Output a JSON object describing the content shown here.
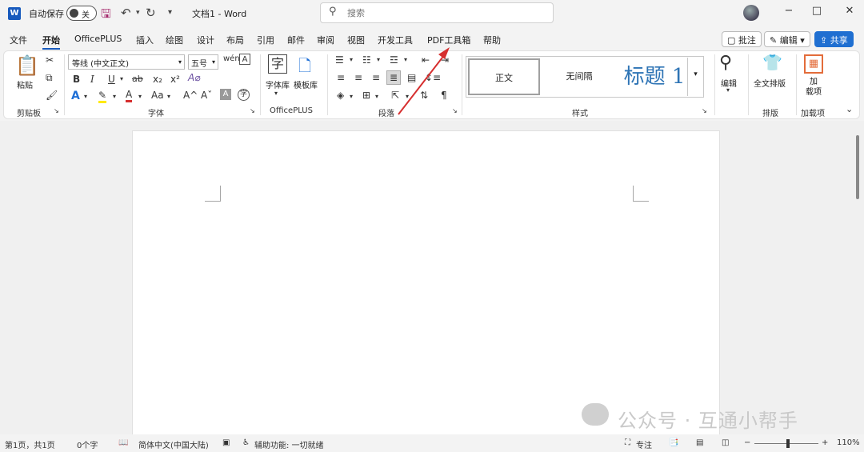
{
  "titlebar": {
    "app_logo": "W",
    "autosave_label": "自动保存",
    "autosave_state": "关",
    "doc_title": "文档1 - Word",
    "search_placeholder": "搜索",
    "window_controls": {
      "minimize": "−",
      "maximize": "□",
      "close": "✕"
    }
  },
  "menu": {
    "tabs": [
      "文件",
      "开始",
      "OfficePLUS",
      "插入",
      "绘图",
      "设计",
      "布局",
      "引用",
      "邮件",
      "审阅",
      "视图",
      "开发工具",
      "PDF工具箱",
      "帮助"
    ],
    "active_tab": "开始",
    "comments": "批注",
    "editing": "编辑",
    "share": "共享"
  },
  "ribbon": {
    "clipboard": {
      "paste": "粘贴",
      "label": "剪贴板"
    },
    "font": {
      "name": "等线 (中文正文)",
      "size": "五号",
      "label": "字体",
      "buttons": [
        "B",
        "I",
        "U",
        "ab",
        "x₂",
        "x²",
        "A",
        "A",
        "A",
        "Aa",
        "A^",
        "Aˇ",
        "A",
        "字"
      ]
    },
    "officeplus": {
      "font_lib": "字体库",
      "template_lib": "模板库",
      "label": "OfficePLUS"
    },
    "paragraph": {
      "label": "段落"
    },
    "styles": {
      "items": [
        "正文",
        "无间隔",
        "标题 1"
      ],
      "label": "样式"
    },
    "editing": {
      "label": "编辑"
    },
    "layout": {
      "fulltext": "全文排版",
      "label": "排版"
    },
    "addins": {
      "button": "加\n载项",
      "label": "加载项"
    }
  },
  "watermark": "公众号 · 互通小帮手",
  "status": {
    "page": "第1页，共1页",
    "words": "0个字",
    "language": "简体中文(中国大陆)",
    "accessibility": "辅助功能: 一切就绪",
    "focus": "专注",
    "zoom": "110%"
  },
  "colors": {
    "word_blue": "#185abd",
    "share_blue": "#1f6fd1",
    "heading_blue": "#2e74b5",
    "annotation_red": "#d62f2f"
  }
}
